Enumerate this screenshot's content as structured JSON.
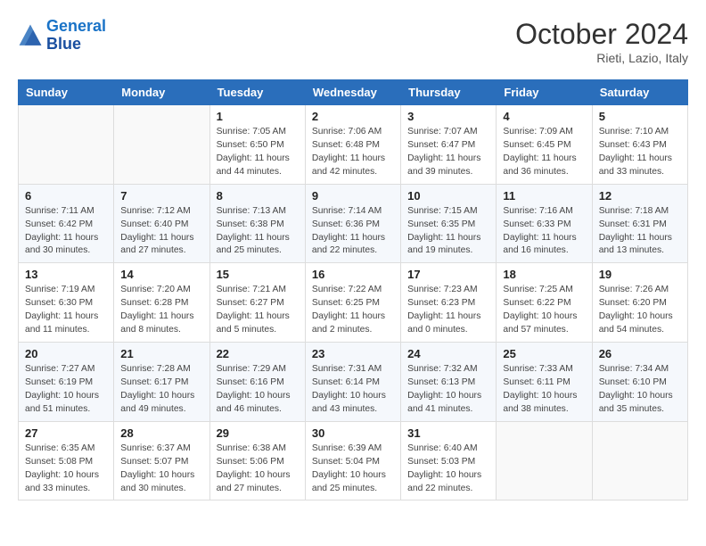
{
  "header": {
    "logo_line1": "General",
    "logo_line2": "Blue",
    "month": "October 2024",
    "location": "Rieti, Lazio, Italy"
  },
  "days_of_week": [
    "Sunday",
    "Monday",
    "Tuesday",
    "Wednesday",
    "Thursday",
    "Friday",
    "Saturday"
  ],
  "weeks": [
    [
      {
        "day": "",
        "info": ""
      },
      {
        "day": "",
        "info": ""
      },
      {
        "day": "1",
        "info": "Sunrise: 7:05 AM\nSunset: 6:50 PM\nDaylight: 11 hours and 44 minutes."
      },
      {
        "day": "2",
        "info": "Sunrise: 7:06 AM\nSunset: 6:48 PM\nDaylight: 11 hours and 42 minutes."
      },
      {
        "day": "3",
        "info": "Sunrise: 7:07 AM\nSunset: 6:47 PM\nDaylight: 11 hours and 39 minutes."
      },
      {
        "day": "4",
        "info": "Sunrise: 7:09 AM\nSunset: 6:45 PM\nDaylight: 11 hours and 36 minutes."
      },
      {
        "day": "5",
        "info": "Sunrise: 7:10 AM\nSunset: 6:43 PM\nDaylight: 11 hours and 33 minutes."
      }
    ],
    [
      {
        "day": "6",
        "info": "Sunrise: 7:11 AM\nSunset: 6:42 PM\nDaylight: 11 hours and 30 minutes."
      },
      {
        "day": "7",
        "info": "Sunrise: 7:12 AM\nSunset: 6:40 PM\nDaylight: 11 hours and 27 minutes."
      },
      {
        "day": "8",
        "info": "Sunrise: 7:13 AM\nSunset: 6:38 PM\nDaylight: 11 hours and 25 minutes."
      },
      {
        "day": "9",
        "info": "Sunrise: 7:14 AM\nSunset: 6:36 PM\nDaylight: 11 hours and 22 minutes."
      },
      {
        "day": "10",
        "info": "Sunrise: 7:15 AM\nSunset: 6:35 PM\nDaylight: 11 hours and 19 minutes."
      },
      {
        "day": "11",
        "info": "Sunrise: 7:16 AM\nSunset: 6:33 PM\nDaylight: 11 hours and 16 minutes."
      },
      {
        "day": "12",
        "info": "Sunrise: 7:18 AM\nSunset: 6:31 PM\nDaylight: 11 hours and 13 minutes."
      }
    ],
    [
      {
        "day": "13",
        "info": "Sunrise: 7:19 AM\nSunset: 6:30 PM\nDaylight: 11 hours and 11 minutes."
      },
      {
        "day": "14",
        "info": "Sunrise: 7:20 AM\nSunset: 6:28 PM\nDaylight: 11 hours and 8 minutes."
      },
      {
        "day": "15",
        "info": "Sunrise: 7:21 AM\nSunset: 6:27 PM\nDaylight: 11 hours and 5 minutes."
      },
      {
        "day": "16",
        "info": "Sunrise: 7:22 AM\nSunset: 6:25 PM\nDaylight: 11 hours and 2 minutes."
      },
      {
        "day": "17",
        "info": "Sunrise: 7:23 AM\nSunset: 6:23 PM\nDaylight: 11 hours and 0 minutes."
      },
      {
        "day": "18",
        "info": "Sunrise: 7:25 AM\nSunset: 6:22 PM\nDaylight: 10 hours and 57 minutes."
      },
      {
        "day": "19",
        "info": "Sunrise: 7:26 AM\nSunset: 6:20 PM\nDaylight: 10 hours and 54 minutes."
      }
    ],
    [
      {
        "day": "20",
        "info": "Sunrise: 7:27 AM\nSunset: 6:19 PM\nDaylight: 10 hours and 51 minutes."
      },
      {
        "day": "21",
        "info": "Sunrise: 7:28 AM\nSunset: 6:17 PM\nDaylight: 10 hours and 49 minutes."
      },
      {
        "day": "22",
        "info": "Sunrise: 7:29 AM\nSunset: 6:16 PM\nDaylight: 10 hours and 46 minutes."
      },
      {
        "day": "23",
        "info": "Sunrise: 7:31 AM\nSunset: 6:14 PM\nDaylight: 10 hours and 43 minutes."
      },
      {
        "day": "24",
        "info": "Sunrise: 7:32 AM\nSunset: 6:13 PM\nDaylight: 10 hours and 41 minutes."
      },
      {
        "day": "25",
        "info": "Sunrise: 7:33 AM\nSunset: 6:11 PM\nDaylight: 10 hours and 38 minutes."
      },
      {
        "day": "26",
        "info": "Sunrise: 7:34 AM\nSunset: 6:10 PM\nDaylight: 10 hours and 35 minutes."
      }
    ],
    [
      {
        "day": "27",
        "info": "Sunrise: 6:35 AM\nSunset: 5:08 PM\nDaylight: 10 hours and 33 minutes."
      },
      {
        "day": "28",
        "info": "Sunrise: 6:37 AM\nSunset: 5:07 PM\nDaylight: 10 hours and 30 minutes."
      },
      {
        "day": "29",
        "info": "Sunrise: 6:38 AM\nSunset: 5:06 PM\nDaylight: 10 hours and 27 minutes."
      },
      {
        "day": "30",
        "info": "Sunrise: 6:39 AM\nSunset: 5:04 PM\nDaylight: 10 hours and 25 minutes."
      },
      {
        "day": "31",
        "info": "Sunrise: 6:40 AM\nSunset: 5:03 PM\nDaylight: 10 hours and 22 minutes."
      },
      {
        "day": "",
        "info": ""
      },
      {
        "day": "",
        "info": ""
      }
    ]
  ]
}
